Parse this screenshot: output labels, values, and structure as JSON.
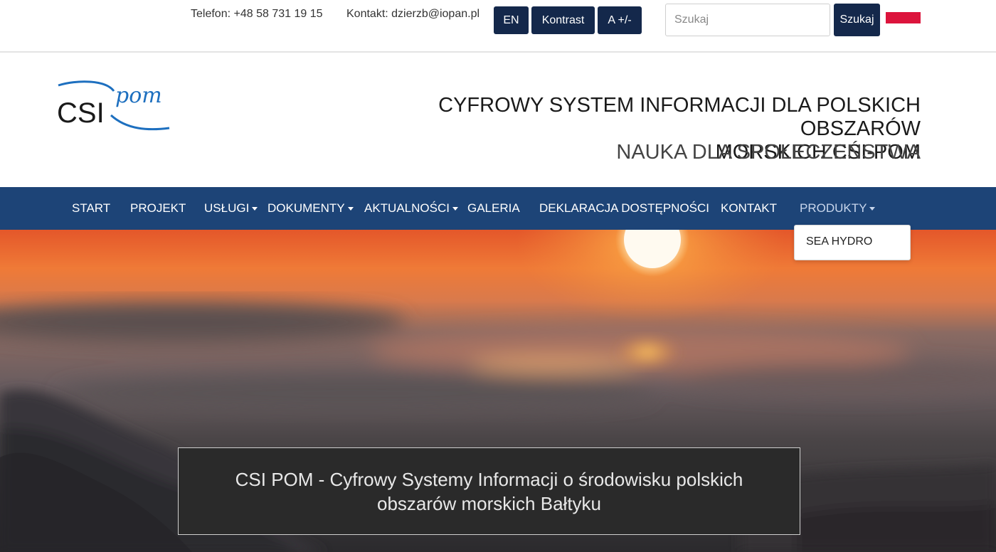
{
  "topbar": {
    "phone": "Telefon: +48 58 731 19 15",
    "email": "Kontakt: dzierzb@iopan.pl",
    "buttons": {
      "language": "EN",
      "contrast": "Kontrast",
      "font_size": "A +/-"
    },
    "search": {
      "placeholder": "Szukaj",
      "button_label": "Szukaj"
    },
    "flag": "poland-flag-icon"
  },
  "header": {
    "logo_text": "CSI",
    "logo_script": "pom",
    "title_line1": "CYFROWY SYSTEM INFORMACJI DLA POLSKICH OBSZARÓW",
    "title_line2": "MORSKICH CSI-POM",
    "subtitle": "NAUKA DLA SPOŁECZEŃSTWA"
  },
  "nav": {
    "items": [
      {
        "label": "START",
        "dropdown": false
      },
      {
        "label": "PROJEKT",
        "dropdown": false
      },
      {
        "label": "USŁUGI",
        "dropdown": true
      },
      {
        "label": "DOKUMENTY",
        "dropdown": true
      },
      {
        "label": "AKTUALNOŚCI",
        "dropdown": true
      },
      {
        "label": "GALERIA",
        "dropdown": false
      },
      {
        "label": "DEKLARACJA DOSTĘPNOŚCI",
        "dropdown": false
      },
      {
        "label": "KONTAKT",
        "dropdown": false
      },
      {
        "label": "PRODUKTY",
        "dropdown": true
      }
    ],
    "open_dropdown": {
      "items": [
        {
          "label": "SEA HYDRO"
        }
      ]
    }
  },
  "hero": {
    "caption": "CSI POM - Cyfrowy Systemy Informacji o środowisku polskich obszarów morskich Bałtyku"
  },
  "colors": {
    "nav_bg": "#1d4477",
    "button_bg": "#14284b",
    "caption_bg": "#2a2a2a",
    "logo_blue": "#1d6fbf"
  }
}
